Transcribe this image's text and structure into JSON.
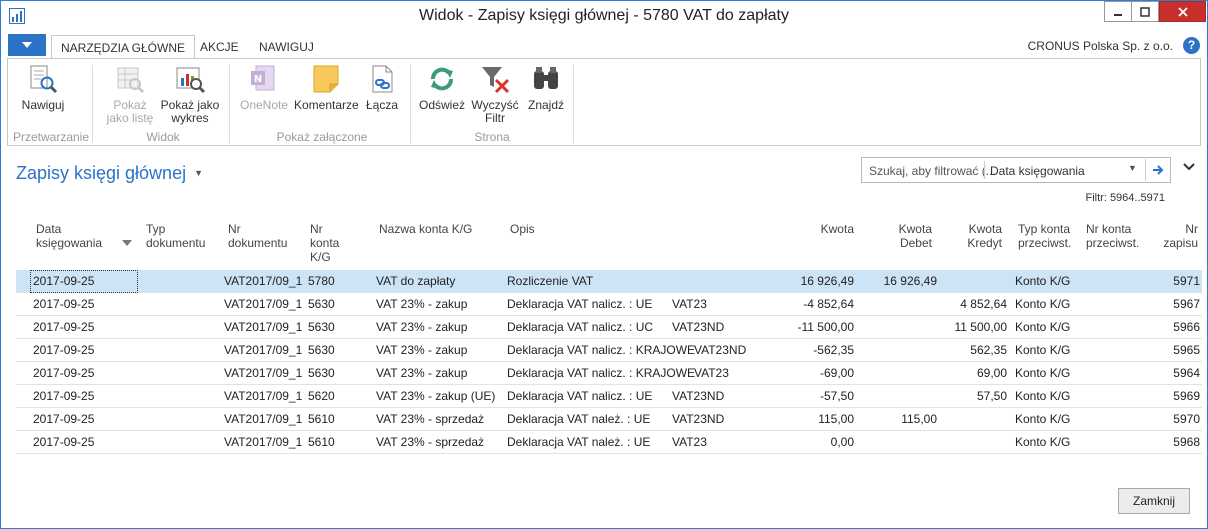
{
  "window": {
    "title": "Widok - Zapisy księgi głównej - 5780 VAT do zapłaty"
  },
  "tabs": [
    "NARZĘDZIA GŁÓWNE",
    "AKCJE",
    "NAWIGUJ"
  ],
  "company": "CRONUS Polska Sp. z o.o.",
  "help_label": "?",
  "ribbon": {
    "groups": [
      {
        "label": "Przetwarzanie",
        "buttons": [
          {
            "label": "Nawiguj",
            "icon": "navigate-icon",
            "enabled": true
          }
        ]
      },
      {
        "label": "Widok",
        "buttons": [
          {
            "label": "Pokaż jako listę",
            "line1": "Pokaż",
            "line2": "jako listę",
            "icon": "list-icon",
            "enabled": false
          },
          {
            "label": "Pokaż jako wykres",
            "line1": "Pokaż jako",
            "line2": "wykres",
            "icon": "chart-icon",
            "enabled": true
          }
        ]
      },
      {
        "label": "Pokaż załączone",
        "buttons": [
          {
            "label": "OneNote",
            "icon": "onenote-icon",
            "enabled": false
          },
          {
            "label": "Komentarze",
            "icon": "notes-icon",
            "enabled": true
          },
          {
            "label": "Łącza",
            "icon": "links-icon",
            "enabled": true
          }
        ]
      },
      {
        "label": "Strona",
        "buttons": [
          {
            "label": "Odśwież",
            "icon": "refresh-icon",
            "enabled": true
          },
          {
            "label": "Wyczyść Filtr",
            "line1": "Wyczyść",
            "line2": "Filtr",
            "icon": "clear-filter-icon",
            "enabled": true
          },
          {
            "label": "Znajdź",
            "icon": "find-icon",
            "enabled": true
          }
        ]
      }
    ]
  },
  "page": {
    "title": "Zapisy księgi głównej",
    "filter_placeholder": "Szukaj, aby filtrować (...",
    "filter_field": "Data księgowania",
    "filter_note": "Filtr: 5964..5971"
  },
  "columns": {
    "data": [
      "Data",
      "księgowania"
    ],
    "typ": [
      "Typ",
      "dokumentu"
    ],
    "nr_dok": [
      "Nr",
      "dokumentu"
    ],
    "nr_konta": [
      "Nr",
      "konta",
      "K/G"
    ],
    "nazwa": [
      "Nazwa konta K/G"
    ],
    "opis": [
      "Opis"
    ],
    "kwota": [
      "Kwota"
    ],
    "debet": [
      "Kwota",
      "Debet"
    ],
    "kredyt": [
      "Kwota",
      "Kredyt"
    ],
    "typ_przec": [
      "Typ konta",
      "przeciwst."
    ],
    "nr_przec": [
      "Nr konta",
      "przeciwst."
    ],
    "nr_zapisu": [
      "Nr",
      "zapisu"
    ]
  },
  "rows": [
    {
      "date": "2017-09-25",
      "doc_type": "",
      "doc_no": "VAT2017/09_1",
      "acc_no": "5780",
      "acc_name": "VAT do zapłaty",
      "desc": "Rozliczenie VAT",
      "desc_code": "",
      "amount": "16 926,49",
      "debit": "16 926,49",
      "credit": "",
      "bal_type": "Konto K/G",
      "bal_no": "",
      "entry_no": "5971",
      "selected": true
    },
    {
      "date": "2017-09-25",
      "doc_type": "",
      "doc_no": "VAT2017/09_1",
      "acc_no": "5630",
      "acc_name": "VAT 23% - zakup",
      "desc": "Deklaracja VAT nalicz. : UE",
      "desc_code": "VAT23",
      "amount": "-4 852,64",
      "debit": "",
      "credit": "4 852,64",
      "bal_type": "Konto K/G",
      "bal_no": "",
      "entry_no": "5967",
      "selected": false
    },
    {
      "date": "2017-09-25",
      "doc_type": "",
      "doc_no": "VAT2017/09_1",
      "acc_no": "5630",
      "acc_name": "VAT 23% - zakup",
      "desc": "Deklaracja VAT nalicz. : UC",
      "desc_code": "VAT23ND",
      "amount": "-11 500,00",
      "debit": "",
      "credit": "11 500,00",
      "bal_type": "Konto K/G",
      "bal_no": "",
      "entry_no": "5966",
      "selected": false
    },
    {
      "date": "2017-09-25",
      "doc_type": "",
      "doc_no": "VAT2017/09_1",
      "acc_no": "5630",
      "acc_name": "VAT 23% - zakup",
      "desc": "Deklaracja VAT nalicz. : KRAJOWE",
      "desc_code": "VAT23ND",
      "amount": "-562,35",
      "debit": "",
      "credit": "562,35",
      "bal_type": "Konto K/G",
      "bal_no": "",
      "entry_no": "5965",
      "selected": false
    },
    {
      "date": "2017-09-25",
      "doc_type": "",
      "doc_no": "VAT2017/09_1",
      "acc_no": "5630",
      "acc_name": "VAT 23% - zakup",
      "desc": "Deklaracja VAT nalicz. : KRAJOWE",
      "desc_code": "VAT23",
      "amount": "-69,00",
      "debit": "",
      "credit": "69,00",
      "bal_type": "Konto K/G",
      "bal_no": "",
      "entry_no": "5964",
      "selected": false
    },
    {
      "date": "2017-09-25",
      "doc_type": "",
      "doc_no": "VAT2017/09_1",
      "acc_no": "5620",
      "acc_name": "VAT 23% - zakup (UE)",
      "desc": "Deklaracja VAT nalicz. : UE",
      "desc_code": "VAT23ND",
      "amount": "-57,50",
      "debit": "",
      "credit": "57,50",
      "bal_type": "Konto K/G",
      "bal_no": "",
      "entry_no": "5969",
      "selected": false
    },
    {
      "date": "2017-09-25",
      "doc_type": "",
      "doc_no": "VAT2017/09_1",
      "acc_no": "5610",
      "acc_name": "VAT 23% - sprzedaż",
      "desc": "Deklaracja VAT należ. : UE",
      "desc_code": "VAT23ND",
      "amount": "115,00",
      "debit": "115,00",
      "credit": "",
      "bal_type": "Konto K/G",
      "bal_no": "",
      "entry_no": "5970",
      "selected": false
    },
    {
      "date": "2017-09-25",
      "doc_type": "",
      "doc_no": "VAT2017/09_1",
      "acc_no": "5610",
      "acc_name": "VAT 23% - sprzedaż",
      "desc": "Deklaracja VAT należ. : UE",
      "desc_code": "VAT23",
      "amount": "0,00",
      "debit": "",
      "credit": "",
      "bal_type": "Konto K/G",
      "bal_no": "",
      "entry_no": "5968",
      "selected": false
    }
  ],
  "buttons": {
    "close": "Zamknij"
  },
  "colors": {
    "accent": "#2b73c7",
    "selected_row": "#cde3f6",
    "close_red": "#c7302b"
  }
}
